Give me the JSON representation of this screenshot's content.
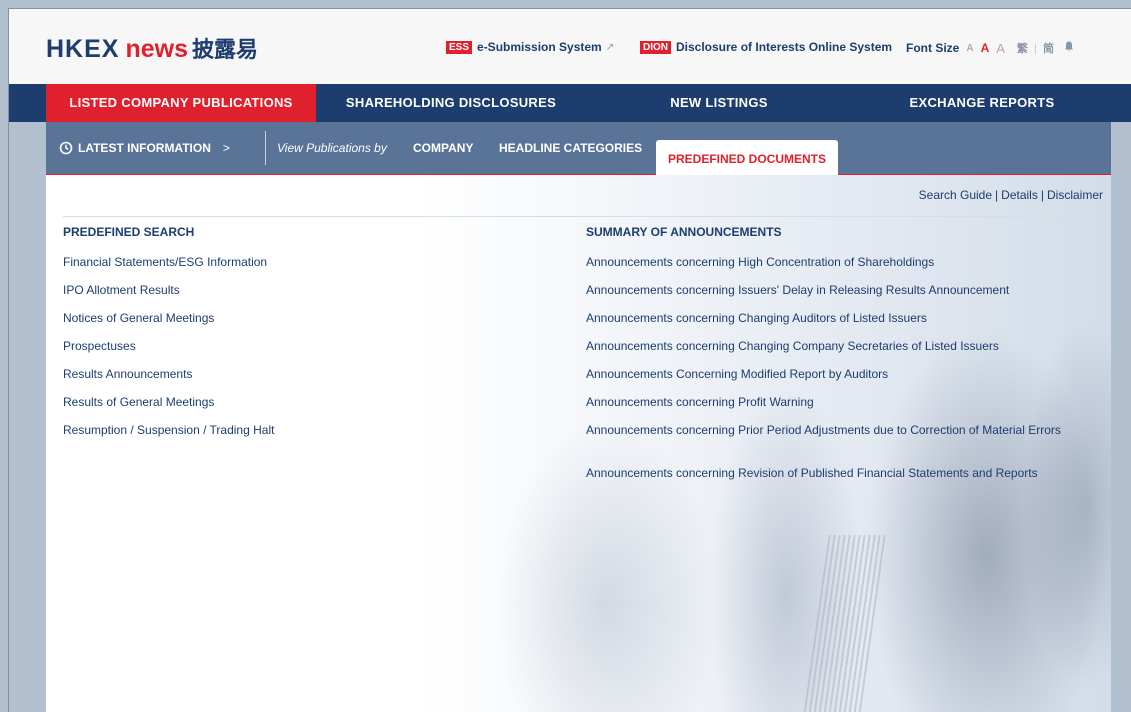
{
  "header": {
    "logo": {
      "hkex": "HKEX",
      "news": "news",
      "chinese": "披露易"
    },
    "ess": {
      "tag": "ESS",
      "label": "e-Submission System",
      "icon": "external-link-icon"
    },
    "dion": {
      "tag": "DION",
      "label": "Disclosure of Interests Online System"
    },
    "font_size": {
      "label": "Font Size",
      "small": "A",
      "medium": "A",
      "large": "A"
    },
    "lang": {
      "traditional": "繁",
      "simplified": "简",
      "icon": "bell-icon"
    }
  },
  "nav": {
    "items": [
      {
        "label": "LISTED COMPANY PUBLICATIONS",
        "active": true
      },
      {
        "label": "SHAREHOLDING DISCLOSURES"
      },
      {
        "label": "NEW LISTINGS"
      },
      {
        "label": "EXCHANGE REPORTS"
      }
    ]
  },
  "subnav": {
    "latest": "LATEST INFORMATION",
    "latest_chevron": ">",
    "view_by": "View Publications by",
    "company": "COMPANY",
    "headline": "HEADLINE CATEGORIES",
    "predefined": "PREDEFINED DOCUMENTS"
  },
  "utility": {
    "search_guide": "Search Guide",
    "details": "Details",
    "disclaimer": "Disclaimer",
    "separator": "|"
  },
  "predefined_search": {
    "title": "PREDEFINED SEARCH",
    "items": [
      "Financial Statements/ESG Information",
      "IPO Allotment Results",
      "Notices of General Meetings",
      "Prospectuses",
      "Results Announcements",
      "Results of General Meetings",
      "Resumption / Suspension / Trading Halt"
    ]
  },
  "summary": {
    "title": "SUMMARY OF ANNOUNCEMENTS",
    "items": [
      "Announcements concerning High Concentration of Shareholdings",
      "Announcements concerning Issuers' Delay in Releasing Results Announcement",
      "Announcements concerning Changing Auditors of Listed Issuers",
      "Announcements concerning Changing Company Secretaries of Listed Issuers",
      "Announcements Concerning Modified Report by Auditors",
      "Announcements concerning Profit Warning",
      "Announcements concerning Prior Period Adjustments due to Correction of Material Errors",
      "Announcements concerning Revision of Published Financial Statements and Reports"
    ]
  },
  "colors": {
    "navy": "#1d3d6e",
    "red": "#e0202d",
    "subnav": "#5a7498"
  }
}
